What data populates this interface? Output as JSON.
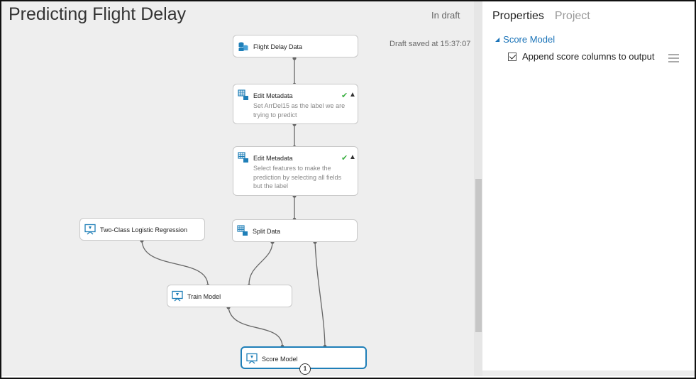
{
  "experiment": {
    "title": "Predicting Flight Delay",
    "status": "In draft",
    "saved_text": "Draft saved at 15:37:07"
  },
  "modules": {
    "flight_delay_data": {
      "title": "Flight Delay Data",
      "icon": "dataset-icon"
    },
    "edit_metadata_1": {
      "title": "Edit Metadata",
      "description": "Set ArrDel15 as the label we are trying to predict",
      "icon": "table-icon"
    },
    "edit_metadata_2": {
      "title": "Edit Metadata",
      "description": "Select features to make the prediction by selecting all fields but the label",
      "icon": "table-icon"
    },
    "logistic_regression": {
      "title": "Two-Class Logistic Regression",
      "icon": "model-icon"
    },
    "split_data": {
      "title": "Split Data",
      "icon": "table-icon"
    },
    "train_model": {
      "title": "Train Model",
      "icon": "model-icon"
    },
    "score_model": {
      "title": "Score Model",
      "icon": "model-icon",
      "badge": "1"
    }
  },
  "properties": {
    "tabs": [
      "Properties",
      "Project"
    ],
    "active_tab": "Properties",
    "section_title": "Score Model",
    "option_label": "Append score columns to output",
    "option_checked": true
  },
  "colors": {
    "accent": "#1f7fb8",
    "check": "#3cb043",
    "canvas": "#eeeeee"
  }
}
